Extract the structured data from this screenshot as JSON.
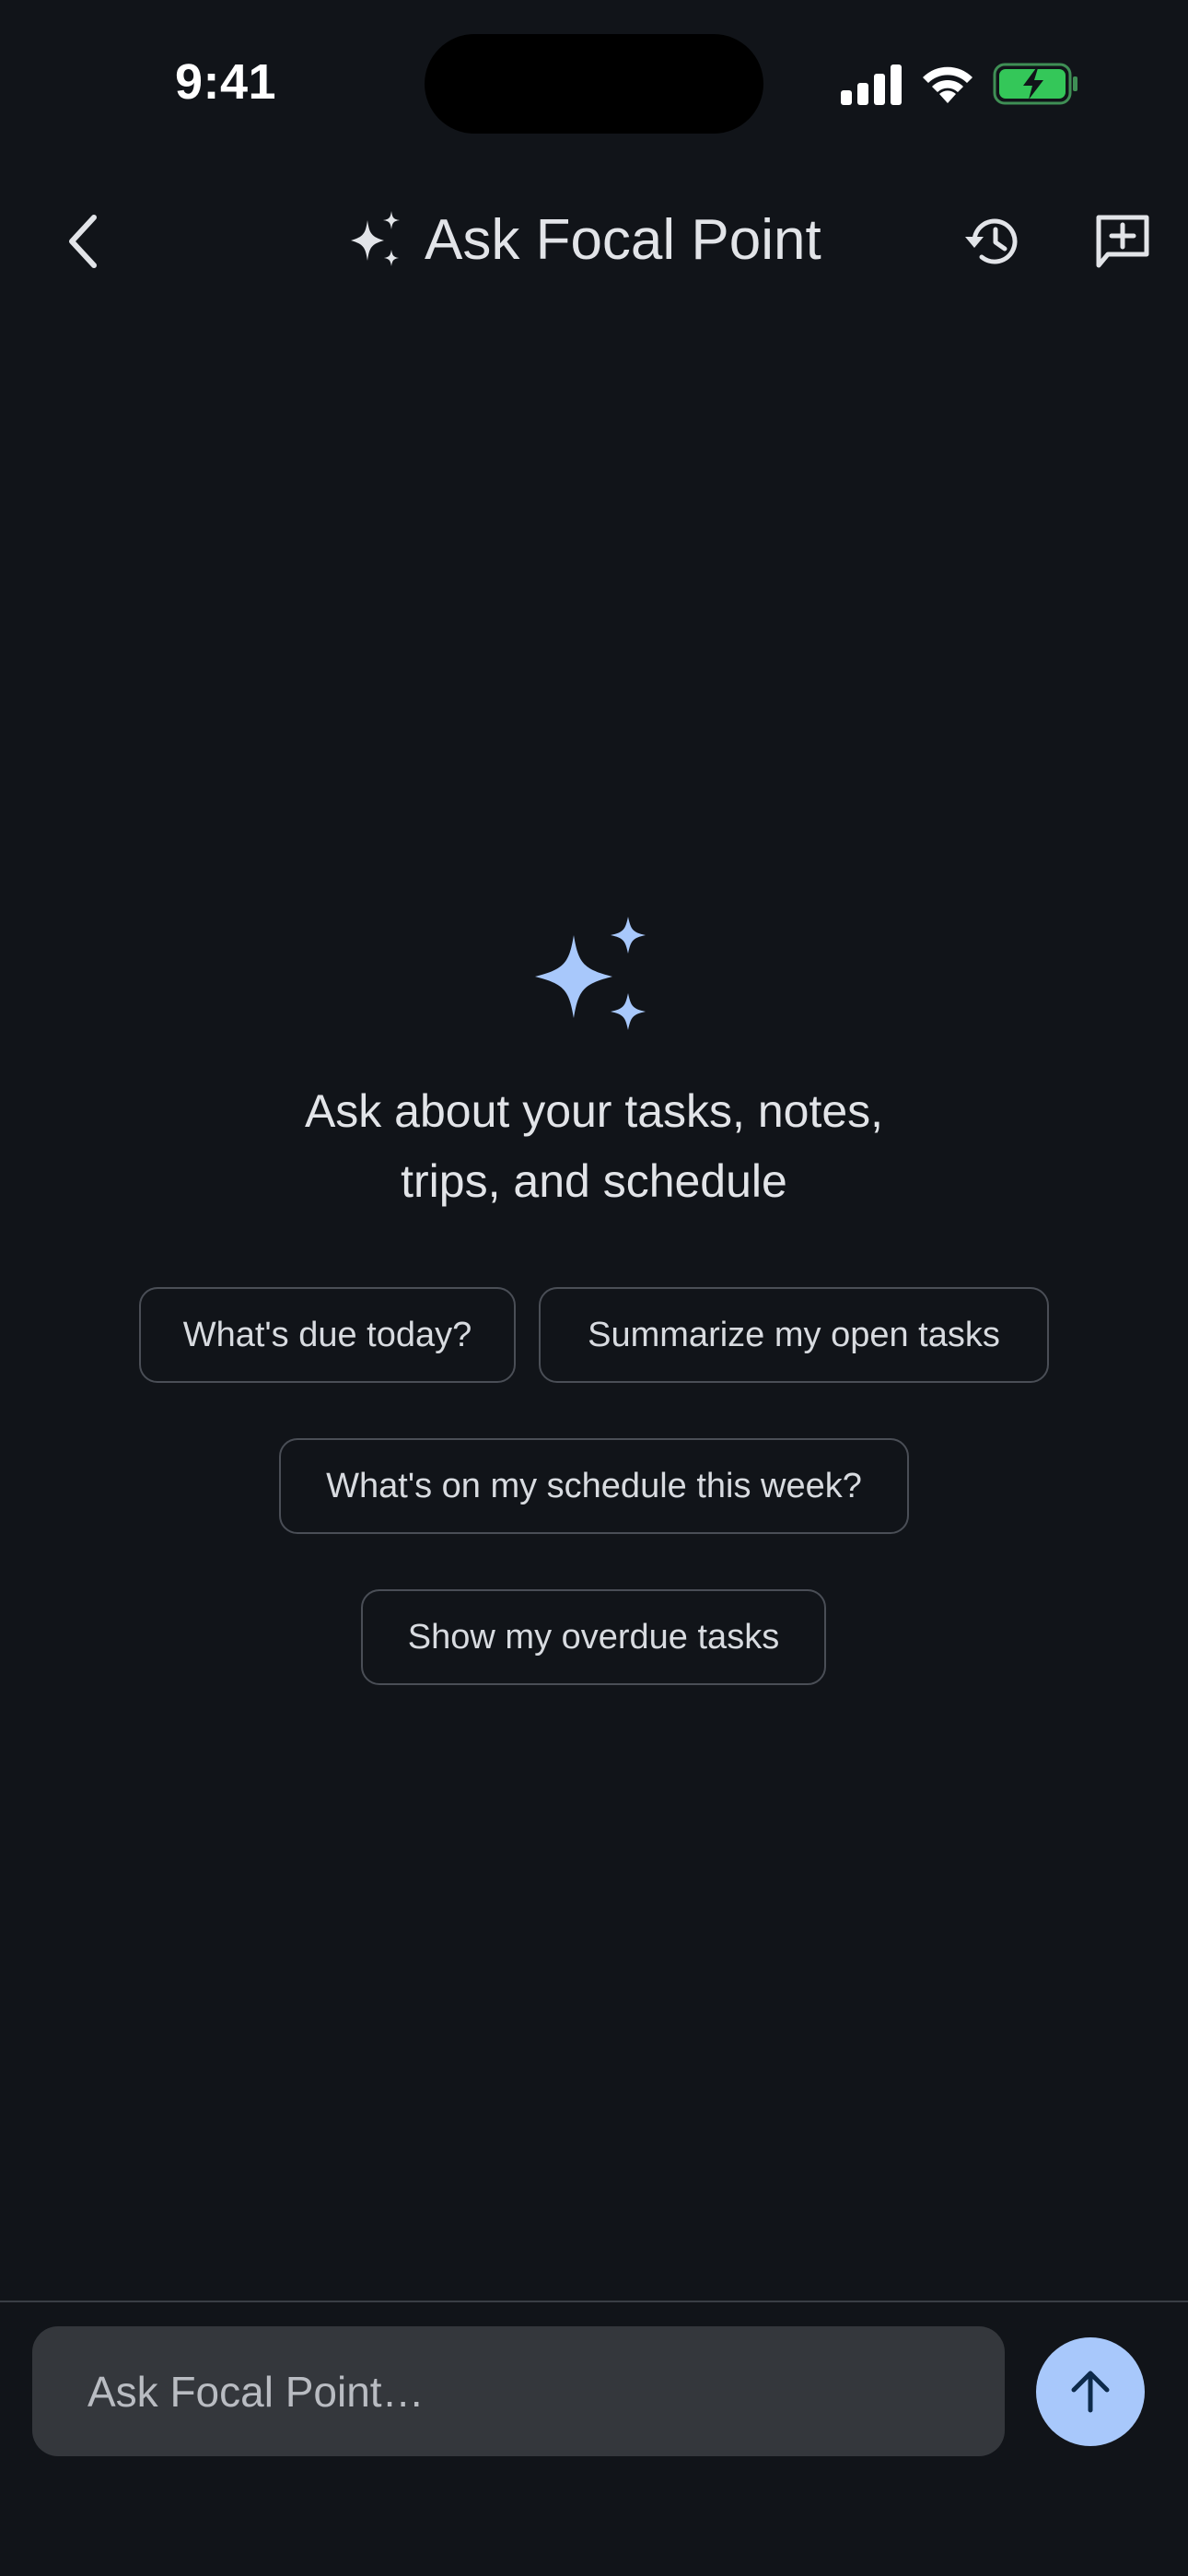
{
  "status_bar": {
    "time": "9:41",
    "icons": [
      "signal-icon",
      "wifi-icon",
      "battery-charging-icon"
    ],
    "battery_color": "#34c759"
  },
  "header": {
    "title": "Ask Focal Point",
    "icons": [
      "back-chevron-icon",
      "sparkle-icon",
      "history-icon",
      "new-chat-icon"
    ]
  },
  "empty_state": {
    "icon": "sparkle-icon",
    "heading_line1": "Ask about your tasks, notes,",
    "heading_line2": "trips, and schedule",
    "suggestions": [
      "What's due today?",
      "Summarize my open tasks",
      "What's on my schedule this week?",
      "Show my overdue tasks"
    ]
  },
  "composer": {
    "placeholder": "Ask Focal Point…",
    "value": "",
    "send_icon": "arrow-up-icon"
  },
  "colors": {
    "background": "#111419",
    "accent": "#a8c8fb",
    "text": "#e2e4e8",
    "chip_border": "#4a4e56",
    "input_background": "#34373c"
  }
}
